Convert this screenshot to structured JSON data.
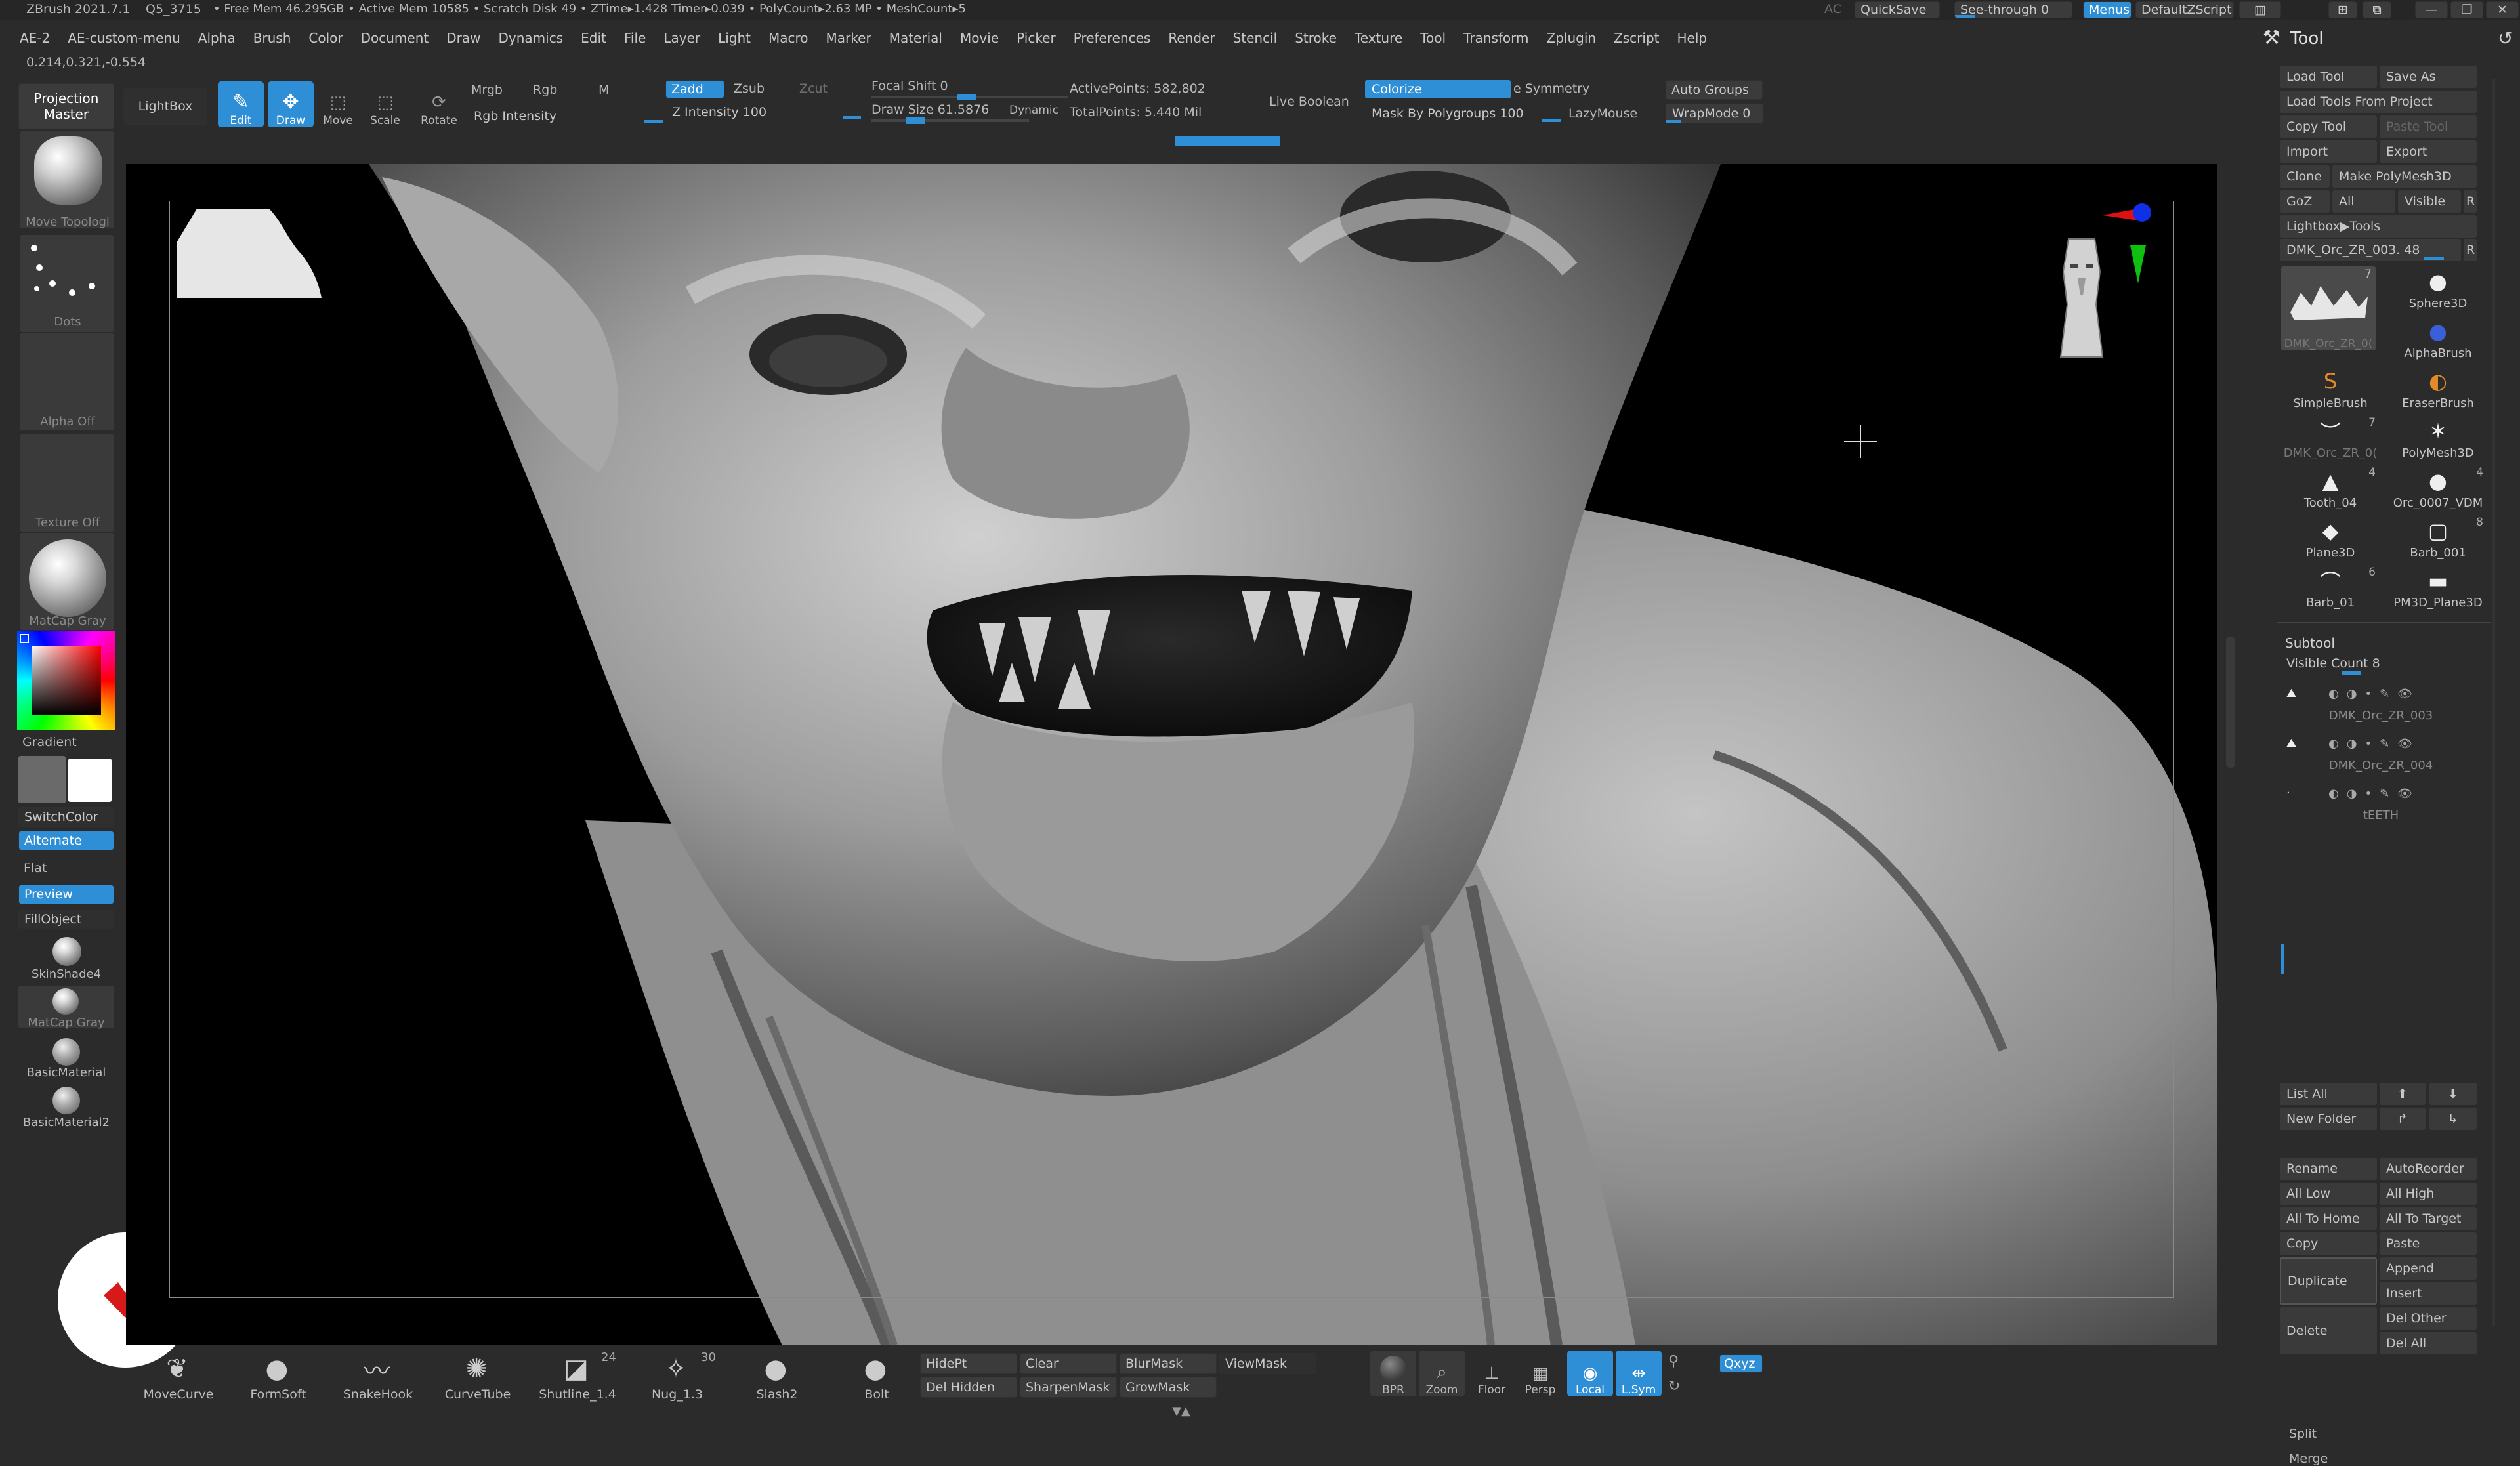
{
  "titlebar": {
    "app": "ZBrush 2021.7.1",
    "doc": "Q5_3715",
    "stats": "• Free Mem 46.295GB • Active Mem 10585 • Scratch Disk 49 • ZTime▸1.428 Timer▸0.039 • PolyCount▸2.63 MP • MeshCount▸5",
    "ac": "AC",
    "quicksave": "QuickSave",
    "seethrough": "See-through 0",
    "menus": "Menus",
    "defaultzscript": "DefaultZScript"
  },
  "menubar": [
    "AE-2",
    "AE-custom-menu",
    "Alpha",
    "Brush",
    "Color",
    "Document",
    "Draw",
    "Dynamics",
    "Edit",
    "File",
    "Layer",
    "Light",
    "Macro",
    "Marker",
    "Material",
    "Movie",
    "Picker",
    "Preferences",
    "Render",
    "Stencil",
    "Stroke",
    "Texture",
    "Tool",
    "Transform",
    "Zplugin",
    "Zscript",
    "Help"
  ],
  "coords": "0.214,0.321,-0.554",
  "toolbar": {
    "projection_master": "Projection Master",
    "lightbox": "LightBox",
    "edit": "Edit",
    "draw": "Draw",
    "move": "Move",
    "scale": "Scale",
    "rotate": "Rotate",
    "mrgb": "Mrgb",
    "rgb": "Rgb",
    "m": "M",
    "rgb_intensity": "Rgb Intensity",
    "zadd": "Zadd",
    "zsub": "Zsub",
    "zcut": "Zcut",
    "z_intensity": "Z Intensity 100",
    "z_intensity_value": 100,
    "focal_shift": "Focal Shift 0",
    "draw_size": "Draw Size 61.5876",
    "draw_size_value": 61.5876,
    "dynamic": "Dynamic",
    "active_points": "ActivePoints: 582,802",
    "total_points": "TotalPoints: 5.440 Mil",
    "live_boolean": "Live Boolean",
    "colorize": "Colorize",
    "symmetry": "e Symmetry",
    "mask_by_polygroups": "Mask By Polygroups 100",
    "lazymouse": "LazyMouse",
    "auto_groups": "Auto Groups",
    "wrapmode": "WrapMode 0"
  },
  "left_shelf": {
    "move_topology": "Move Topologi",
    "dots": "Dots",
    "alpha_off": "Alpha Off",
    "texture_off": "Texture Off",
    "matcap_gray": "MatCap Gray",
    "gradient": "Gradient",
    "switchcolor": "SwitchColor",
    "alternate": "Alternate",
    "flat": "Flat",
    "preview": "Preview",
    "fillobject": "FillObject",
    "skinshade4": "SkinShade4",
    "matcap_gray2": "MatCap Gray",
    "basicmaterial": "BasicMaterial",
    "basicmaterial2": "BasicMaterial2"
  },
  "bottom_brushes": [
    {
      "label": "MoveCurve"
    },
    {
      "label": "FormSoft"
    },
    {
      "label": "SnakeHook"
    },
    {
      "label": "CurveTube"
    },
    {
      "label": "Shutline_1.4",
      "badge": "24"
    },
    {
      "label": "Nug_1.3",
      "badge": "30"
    },
    {
      "label": "Slash2"
    },
    {
      "label": "Bolt"
    }
  ],
  "bottom_buttons": {
    "hidept": "HidePt",
    "del_hidden": "Del Hidden",
    "clear": "Clear",
    "sharpenmask": "SharpenMask",
    "blurmask": "BlurMask",
    "growmask": "GrowMask",
    "viewmask": "ViewMask"
  },
  "bottom_right_icons": {
    "bpr": "BPR",
    "zoom": "Zoom",
    "floor": "Floor",
    "persp": "Persp",
    "local": "Local",
    "lsym": "L.Sym",
    "xyz": "Qxyz"
  },
  "tool_panel": {
    "title": "Tool",
    "load_tool": "Load Tool",
    "save_as": "Save As",
    "load_tools_from_project": "Load Tools From Project",
    "copy_tool": "Copy Tool",
    "paste_tool": "Paste Tool",
    "import": "Import",
    "export": "Export",
    "clone": "Clone",
    "make_polymesh3d": "Make PolyMesh3D",
    "goz": "GoZ",
    "all": "All",
    "visible": "Visible",
    "r": "R",
    "lightbox_tools": "Lightbox▶Tools",
    "current_tool": "DMK_Orc_ZR_003. 48",
    "thumbs": [
      {
        "label": "DMK_Orc_ZR_0(",
        "badge": "7"
      },
      {
        "label": "Sphere3D"
      },
      {
        "label": "AlphaBrush"
      },
      {
        "label": "SimpleBrush"
      },
      {
        "label": "EraserBrush"
      },
      {
        "label": "DMK_Orc_ZR_0(",
        "badge": "7"
      },
      {
        "label": "PolyMesh3D"
      },
      {
        "label": "Tooth_04",
        "badge": "4"
      },
      {
        "label": "Orc_0007_VDM",
        "badge": "4"
      },
      {
        "label": "Plane3D"
      },
      {
        "label": "Barb_001",
        "badge": "8"
      },
      {
        "label": "Barb_01",
        "badge": "6"
      },
      {
        "label": "PM3D_Plane3D"
      }
    ]
  },
  "subtool": {
    "title": "Subtool",
    "visible_count": "Visible Count 8",
    "items": [
      "DMK_Orc_ZR_003",
      "DMK_Orc_ZR_004",
      "tEETH"
    ],
    "list_all": "List All",
    "new_folder": "New Folder",
    "rename": "Rename",
    "autoreorder": "AutoReorder",
    "all_low": "All Low",
    "all_high": "All High",
    "all_to_home": "All To Home",
    "all_to_target": "All To Target",
    "copy": "Copy",
    "paste": "Paste",
    "duplicate": "Duplicate",
    "append": "Append",
    "insert": "Insert",
    "delete": "Delete",
    "del_other": "Del Other",
    "del_all": "Del All",
    "split": "Split",
    "merge": "Merge"
  },
  "colors": {
    "accent": "#2e8fd6",
    "bg": "#2b2b2b",
    "canvas": "#000000",
    "badge_red": "#d61a1a"
  }
}
